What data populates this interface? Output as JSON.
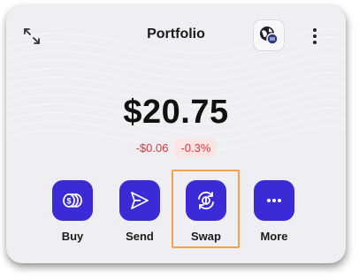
{
  "header": {
    "title": "Portfolio",
    "expand_icon": "expand-arrows-icon",
    "network_icon": "globe-network-icon",
    "menu_icon": "kebab-menu-icon"
  },
  "balance": {
    "amount": "$20.75",
    "change_abs": "-$0.06",
    "change_pct": "-0.3%"
  },
  "actions": [
    {
      "label": "Buy",
      "icon": "coins-icon"
    },
    {
      "label": "Send",
      "icon": "paper-plane-icon"
    },
    {
      "label": "Swap",
      "icon": "swap-icon"
    },
    {
      "label": "More",
      "icon": "more-dots-icon"
    }
  ],
  "colors": {
    "accent": "#3a2bd6",
    "negative": "#d9383b",
    "negative_bg": "#fde4e4",
    "card_bg": "#efeef2",
    "highlight": "#f6a04a"
  }
}
